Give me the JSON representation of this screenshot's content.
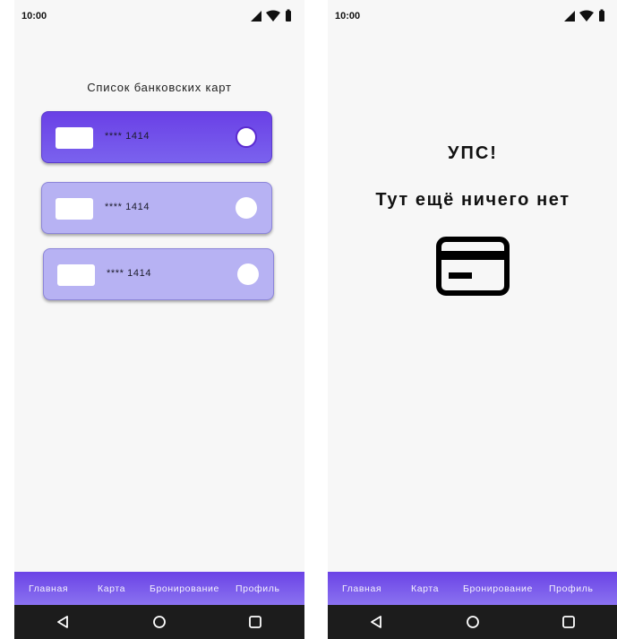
{
  "status_bar": {
    "time": "10:00"
  },
  "left_screen": {
    "title": "Список банковских карт",
    "cards": [
      {
        "number": "**** 1414",
        "selected": true
      },
      {
        "number": "**** 1414",
        "selected": false
      },
      {
        "number": "**** 1414",
        "selected": false
      }
    ]
  },
  "right_screen": {
    "oops": "УПС!",
    "empty_message": "Тут ещё ничего нет",
    "empty_icon": "credit-card-icon"
  },
  "bottom_nav": {
    "items": [
      "Главная",
      "Карта",
      "Бронирование",
      "Профиль"
    ]
  },
  "system_nav": {
    "buttons": [
      "back-icon",
      "home-icon",
      "recents-icon"
    ]
  },
  "colors": {
    "accent": "#6a40e6",
    "card_inactive": "#b7b2f3",
    "nav_gradient_end": "#8a72f0",
    "system_nav": "#1c1c1c"
  }
}
